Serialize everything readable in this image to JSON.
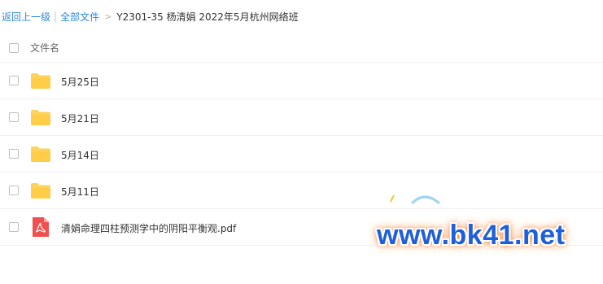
{
  "breadcrumb": {
    "back_label": "返回上一级",
    "separator_bar": "|",
    "all_files_label": "全部文件",
    "separator_arrow": ">",
    "current_folder": "Y2301-35 杨清娟 2022年5月杭州网络班"
  },
  "list": {
    "header_label": "文件名",
    "rows": [
      {
        "name": "5月25日",
        "type": "folder-icon"
      },
      {
        "name": "5月21日",
        "type": "folder-icon"
      },
      {
        "name": "5月14日",
        "type": "folder-icon"
      },
      {
        "name": "5月11日",
        "type": "folder-icon"
      },
      {
        "name": "清娟命理四柱预测学中的阴阳平衡观.pdf",
        "type": "pdf-icon"
      }
    ]
  },
  "watermark": {
    "text": "www.bk41.net"
  },
  "colors": {
    "link": "#2f88dc",
    "folder": "#ffd35b",
    "pdf": "#f0504f",
    "watermark": "#1f5fd8",
    "watermark_glow": "#ff6a1a"
  }
}
